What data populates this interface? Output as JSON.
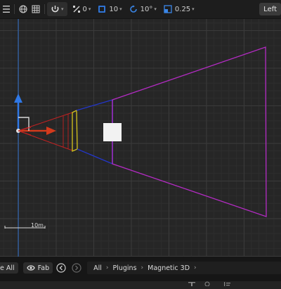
{
  "toolbar": {
    "snap_translate": "0",
    "grid_size": "10",
    "rotation_snap": "10°",
    "scale_snap": "0.25",
    "view_mode": "Left"
  },
  "viewport": {
    "scale_bar_label": "10m"
  },
  "content_browser": {
    "save_all": "e All",
    "fab": "Fab",
    "breadcrumbs": [
      "All",
      "Plugins",
      "Magnetic 3D"
    ]
  }
}
